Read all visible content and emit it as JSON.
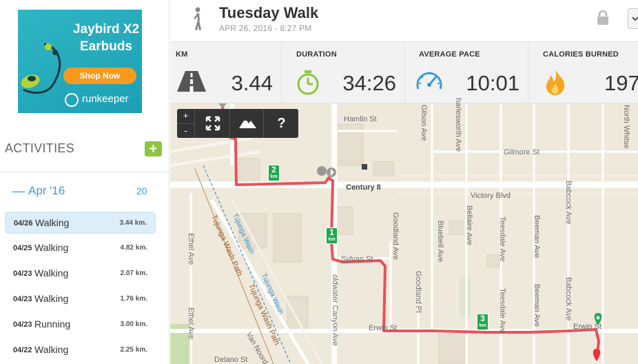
{
  "ad": {
    "title": "Jaybird X2 Earbuds",
    "button": "Shop Now",
    "brand": "runkeeper"
  },
  "activities": {
    "header": "ACTIVITIES",
    "month": {
      "label": "Apr '16",
      "count": "20"
    },
    "items": [
      {
        "date": "04/26",
        "type": "Walking",
        "km": "3.44 km.",
        "selected": true
      },
      {
        "date": "04/25",
        "type": "Walking",
        "km": "4.82 km."
      },
      {
        "date": "04/23",
        "type": "Walking",
        "km": "2.07 km."
      },
      {
        "date": "04/23",
        "type": "Walking",
        "km": "1.76 km."
      },
      {
        "date": "04/23",
        "type": "Running",
        "km": "3.00 km."
      },
      {
        "date": "04/22",
        "type": "Walking",
        "km": "2.25 km."
      }
    ]
  },
  "header": {
    "title": "Tuesday Walk",
    "date": "APR 26, 2016  -  8:27 PM"
  },
  "stats": [
    {
      "label": "KM",
      "value": "3.44",
      "icon": "road-icon"
    },
    {
      "label": "DURATION",
      "value": "34:26",
      "icon": "stopwatch-icon"
    },
    {
      "label": "AVERAGE PACE",
      "value": "10:01",
      "icon": "speedometer-icon"
    },
    {
      "label": "CALORIES BURNED",
      "value": "197",
      "icon": "flame-icon"
    }
  ],
  "map": {
    "controls": {
      "zoom_in": "+",
      "zoom_out": "-",
      "help": "?"
    },
    "streets": {
      "hamlin": "Hamlin St",
      "gilmore": "Gilmore St",
      "victory": "Victory Blvd",
      "century": "Century 8",
      "sylvan": "Sylvan St",
      "erwin": "Erwin St",
      "erwin2": "Erwin St",
      "gilson": "Gilson Ave",
      "charlesworth": "harlesworth Ave",
      "north_whitsett": "North Whitse",
      "babcock_top": "Babcock Ave",
      "babcock_bottom": "Babcock Ave",
      "goodland_ave": "Goodland Ave",
      "goodland_pl": "Goodland Pl",
      "bluebell": "Bluebell Ave",
      "bellaire": "Bellaire Ave",
      "teesdale_top": "Teesdale Ave",
      "teesdale_bottom": "Teesdale Ave",
      "beeman_top": "Beeman Ave",
      "beeman_bottom": "Beeman Ave",
      "coldwater": "oldwater Canyon Ave",
      "ethel_top": "Ethel Ave",
      "ethel_bottom": "Ethel Ave",
      "tujunga_wash": "Tujunga Wash",
      "tujunga_wash2": "Tujunga Wash",
      "tujunga_path": "Tujunga Wash Path",
      "tujunga_path2": "Tujunga Wash Path",
      "van_noord": "Van Noord",
      "delano": "Delano St"
    },
    "km_markers": [
      {
        "n": "1",
        "unit": "km"
      },
      {
        "n": "2",
        "unit": "km"
      },
      {
        "n": "3",
        "unit": "km"
      }
    ],
    "colors": {
      "route": "#e8323c",
      "marker": "#1fa84f",
      "map_bg": "#efe9dc",
      "road": "#ffffff"
    }
  }
}
